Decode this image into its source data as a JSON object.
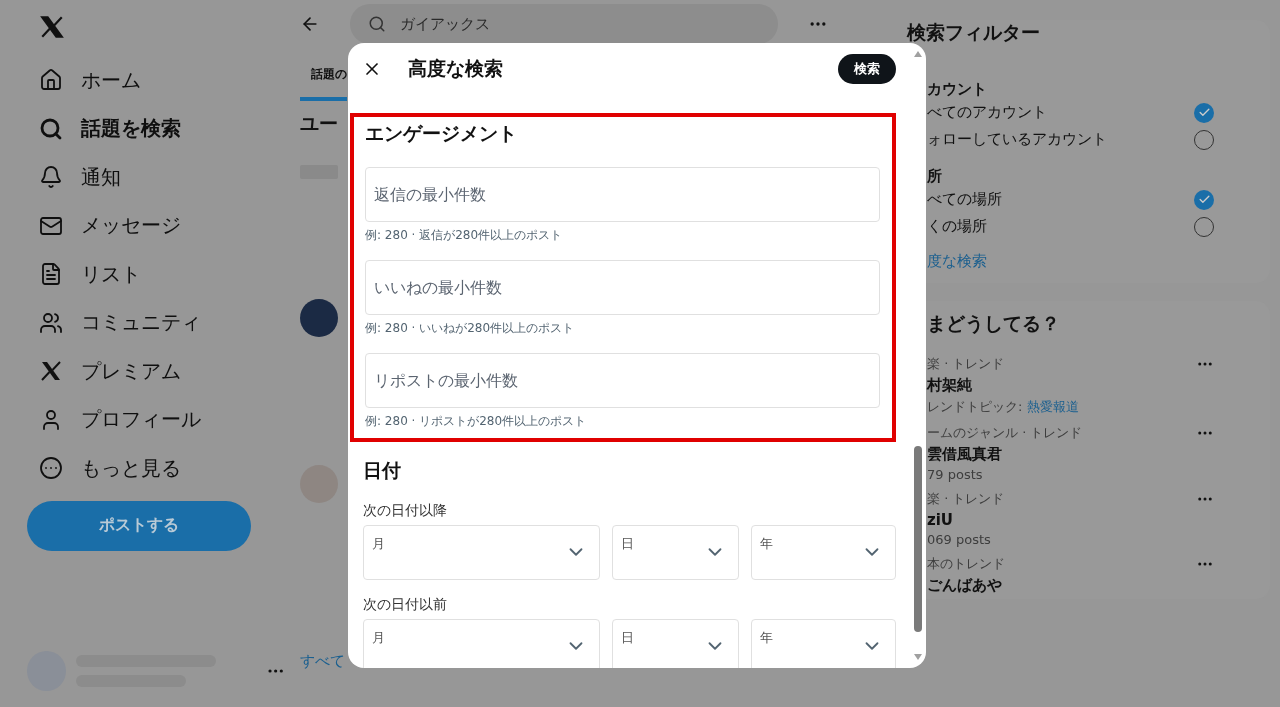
{
  "sidebar": {
    "items": [
      {
        "label": "ホーム",
        "selected": false
      },
      {
        "label": "話題を検索",
        "selected": true
      },
      {
        "label": "通知",
        "selected": false
      },
      {
        "label": "メッセージ",
        "selected": false
      },
      {
        "label": "リスト",
        "selected": false
      },
      {
        "label": "コミュニティ",
        "selected": false
      },
      {
        "label": "プレミアム",
        "selected": false
      },
      {
        "label": "プロフィール",
        "selected": false
      },
      {
        "label": "もっと見る",
        "selected": false
      }
    ],
    "post_button": "ポストする"
  },
  "header": {
    "search_value": "ガイアックス"
  },
  "tabs": [
    {
      "label": "話題の",
      "selected": true
    }
  ],
  "section_title": "ユー",
  "show_all_link": "すべて",
  "dialog": {
    "title": "高度な検索",
    "search_button": "検索",
    "engagement": {
      "heading": "エンゲージメント",
      "fields": [
        {
          "placeholder": "返信の最小件数",
          "hint": "例: 280 · 返信が280件以上のポスト"
        },
        {
          "placeholder": "いいねの最小件数",
          "hint": "例: 280 · いいねが280件以上のポスト"
        },
        {
          "placeholder": "リポストの最小件数",
          "hint": "例: 280 · リポストが280件以上のポスト"
        }
      ]
    },
    "date": {
      "heading": "日付",
      "ranges": [
        {
          "label": "次の日付以降",
          "selects": [
            "月",
            "日",
            "年"
          ]
        },
        {
          "label": "次の日付以前",
          "selects": [
            "月",
            "日",
            "年"
          ]
        }
      ]
    }
  },
  "filters": {
    "title": "検索フィルター",
    "groups": [
      {
        "heading": "カウント",
        "options": [
          {
            "label": "べてのアカウント",
            "selected": true
          },
          {
            "label": "ォローしているアカウント",
            "selected": false
          }
        ]
      },
      {
        "heading": "所",
        "options": [
          {
            "label": "べての場所",
            "selected": true
          },
          {
            "label": "くの場所",
            "selected": false
          }
        ]
      }
    ],
    "link": "度な検索"
  },
  "trends": {
    "title": "まどうしてる？",
    "items": [
      {
        "category": "楽 · トレンド",
        "name": "村架純",
        "topic_label": "レンドトピック: ",
        "topic_link": "熱愛報道"
      },
      {
        "category": "ームのジャンル · トレンド",
        "name": "雲借風真君",
        "posts": "79 posts"
      },
      {
        "category": "楽 · トレンド",
        "name": "ziU",
        "posts": "069 posts"
      },
      {
        "category": "本のトレンド",
        "name": "ごんばあや"
      }
    ]
  }
}
